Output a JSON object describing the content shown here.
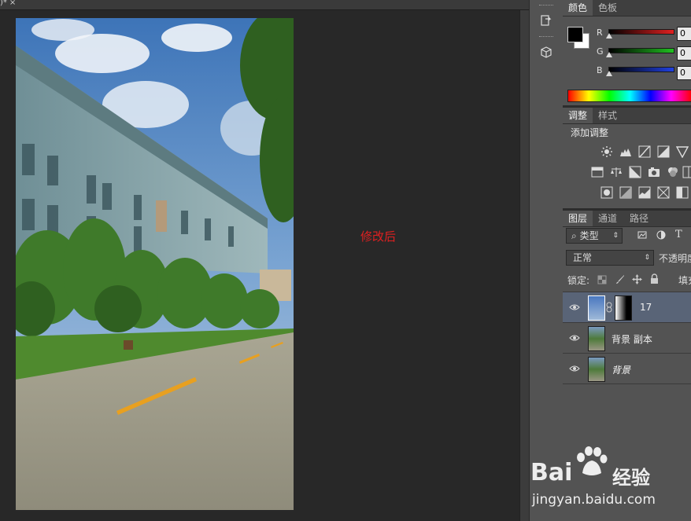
{
  "document": {
    "tab_text": ")*",
    "tab_close": "×",
    "annotation": "修改后"
  },
  "color_panel": {
    "tabs": [
      "颜色",
      "色板"
    ],
    "channels": [
      {
        "label": "R",
        "value": "0",
        "color": "#e02020"
      },
      {
        "label": "G",
        "value": "0",
        "color": "#20c020"
      },
      {
        "label": "B",
        "value": "0",
        "color": "#2040e0"
      }
    ],
    "foreground": "#000000",
    "background": "#ffffff"
  },
  "adjustments_panel": {
    "tabs": [
      "调整",
      "样式"
    ],
    "heading": "添加调整"
  },
  "layers_panel": {
    "tabs": [
      "图层",
      "通道",
      "路径"
    ],
    "filter_kind": "类型",
    "blend_mode": "正常",
    "opacity_label": "不透明度",
    "lock_label": "锁定:",
    "fill_label": "填充",
    "layers": [
      {
        "name": "17",
        "selected": true
      },
      {
        "name": "背景 副本",
        "selected": false
      },
      {
        "name": "背景",
        "selected": false
      }
    ]
  },
  "watermark": {
    "brand_left": "Bai",
    "brand_right": "经验",
    "url": "jingyan.baidu.com"
  }
}
